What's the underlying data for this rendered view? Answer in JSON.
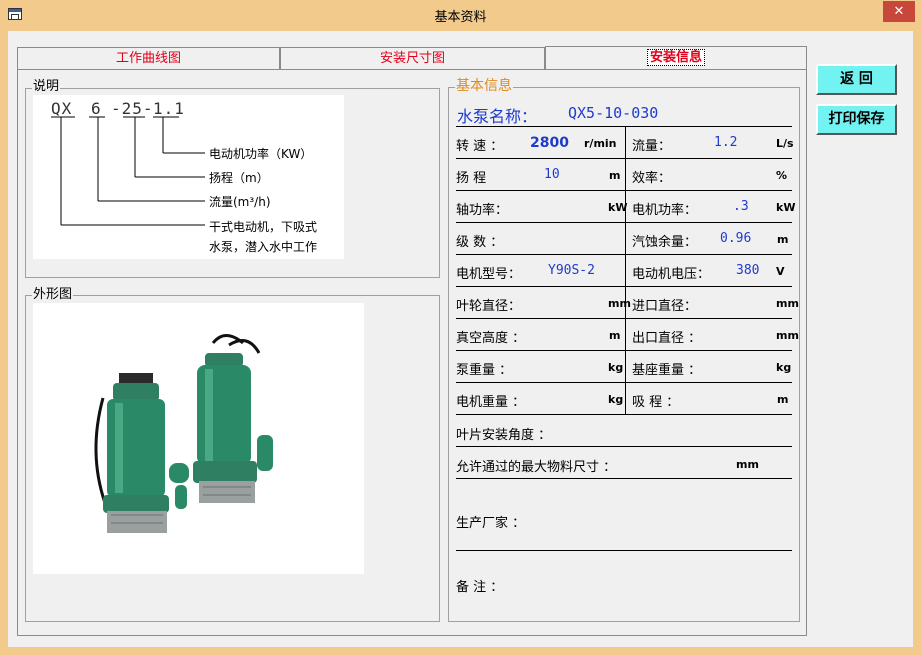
{
  "window": {
    "title": "基本资料",
    "close_label": "✕"
  },
  "tabs": [
    {
      "label": "工作曲线图"
    },
    {
      "label": "安装尺寸图"
    },
    {
      "label": "安装信息"
    }
  ],
  "buttons": {
    "back": "返  回",
    "print": "打印保存"
  },
  "description": {
    "group_label": "说明",
    "code_parts": [
      "QX",
      "6",
      "-25-",
      "1.1"
    ],
    "items": [
      "电动机功率（KW）",
      "扬程（m）",
      "流量(m³/h)",
      "干式电动机，下吸式",
      "水泵，潜入水中工作"
    ]
  },
  "shape": {
    "group_label": "外形图"
  },
  "info": {
    "group_label": "基本信息",
    "pump_name_label": "水泵名称：",
    "pump_name_value": "QX5-10-030",
    "rows": [
      {
        "l_label": "转  速 ：",
        "l_value": "2800",
        "l_unit": "r/min",
        "r_label": "流量：",
        "r_value": "1.2",
        "r_unit": "L/s"
      },
      {
        "l_label": "扬  程",
        "l_value": "10",
        "l_unit": "m",
        "r_label": "效率：",
        "r_value": "",
        "r_unit": "%"
      },
      {
        "l_label": "轴功率：",
        "l_value": "",
        "l_unit": "kW",
        "r_label": "电机功率：",
        "r_value": ".3",
        "r_unit": "kW"
      },
      {
        "l_label": "级  数 ：",
        "l_value": "",
        "l_unit": "",
        "r_label": "汽蚀余量：",
        "r_value": "0.96",
        "r_unit": "m"
      },
      {
        "l_label": "电机型号：",
        "l_value": "Y90S-2",
        "l_unit": "",
        "r_label": "电动机电压：",
        "r_value": "380",
        "r_unit": "V"
      },
      {
        "l_label": "叶轮直径：",
        "l_value": "",
        "l_unit": "mm",
        "r_label": "进口直径：",
        "r_value": "",
        "r_unit": "mm"
      },
      {
        "l_label": "真空高度 ：",
        "l_value": "",
        "l_unit": "m",
        "r_label": "出口直径 ：",
        "r_value": "",
        "r_unit": "mm"
      },
      {
        "l_label": "泵重量 ：",
        "l_value": "",
        "l_unit": "kg",
        "r_label": "基座重量 ：",
        "r_value": "",
        "r_unit": "kg"
      },
      {
        "l_label": "电机重量 ：",
        "l_value": "",
        "l_unit": "kg",
        "r_label": "吸  程 ：",
        "r_value": "",
        "r_unit": "m"
      }
    ],
    "blade_angle_label": "叶片安装角度 ：",
    "max_size_label": "允许通过的最大物料尺寸 ：",
    "max_size_unit": "mm",
    "maker_label": "生产厂家 ：",
    "remark_label": "备  注 ："
  }
}
